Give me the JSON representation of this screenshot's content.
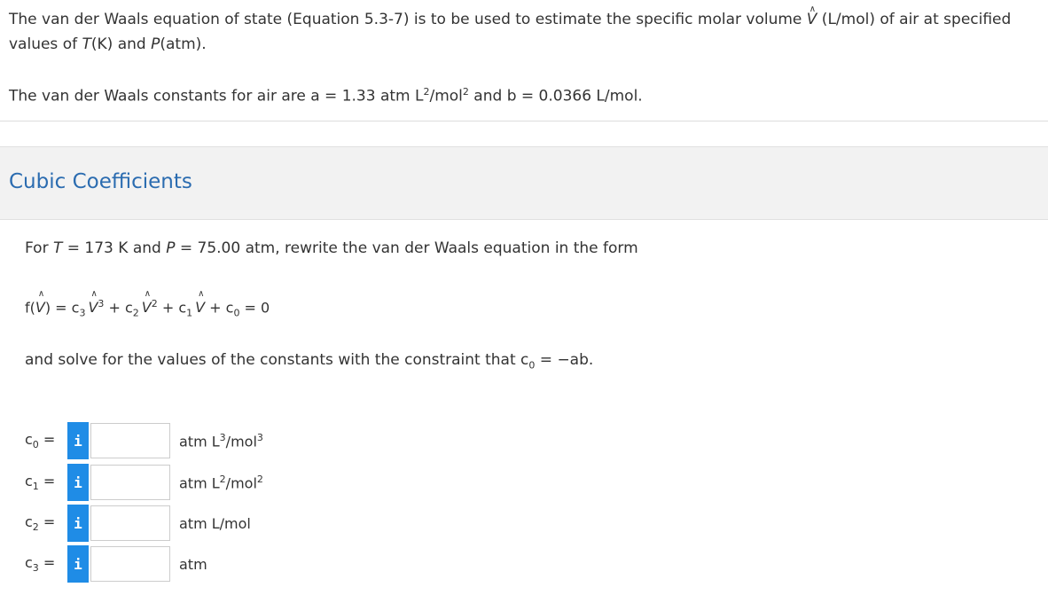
{
  "intro": {
    "line1_a": "The van der Waals equation of state (Equation 5.3-7) is to be used to estimate the specific molar volume ",
    "line1_var": "V",
    "line1_b": " (L/mol) of air at specified values of ",
    "T": "T",
    "line1_c": "(K) and ",
    "P": "P",
    "line1_d": "(atm).",
    "line2_a": "The van der Waals constants for air are a = 1.33 atm L",
    "line2_sup1": "2",
    "line2_b": "/mol",
    "line2_sup2": "2",
    "line2_c": " and b = 0.0366 L/mol."
  },
  "section": {
    "title": "Cubic Coefficients"
  },
  "question": {
    "line_a": "For ",
    "T": "T",
    "line_b": " = 173 K and ",
    "P": "P",
    "line_c": " = 75.00 atm, rewrite the van der Waals equation in the form",
    "eq": {
      "f": "f(",
      "V": "V",
      "close_eq": ") = c",
      "s3": "3",
      "p3": "3",
      "plus_c2": " + c",
      "s2": "2",
      "p2": "2",
      "plus_c1": " + c",
      "s1": "1",
      "plus_c0": " + c",
      "s0": "0",
      "eq0": " = 0"
    },
    "constraint_a": "and solve for the values of the constants with the constraint that c",
    "constraint_sub": "0",
    "constraint_b": " = −ab."
  },
  "answers": [
    {
      "label_c": "c",
      "label_sub": "0",
      "label_eq": " =",
      "info": "i",
      "value": "",
      "unit_a": "atm L",
      "unit_sup1": "3",
      "unit_b": "/mol",
      "unit_sup2": "3"
    },
    {
      "label_c": "c",
      "label_sub": "1",
      "label_eq": " =",
      "info": "i",
      "value": "",
      "unit_a": "atm L",
      "unit_sup1": "2",
      "unit_b": "/mol",
      "unit_sup2": "2"
    },
    {
      "label_c": "c",
      "label_sub": "2",
      "label_eq": " =",
      "info": "i",
      "value": "",
      "unit_a": "atm L/mol",
      "unit_sup1": "",
      "unit_b": "",
      "unit_sup2": ""
    },
    {
      "label_c": "c",
      "label_sub": "3",
      "label_eq": " =",
      "info": "i",
      "value": "",
      "unit_a": "atm",
      "unit_sup1": "",
      "unit_b": "",
      "unit_sup2": ""
    }
  ],
  "colors": {
    "accent": "#1f8ce6",
    "title": "#2b6cb0",
    "band": "#f2f2f2"
  }
}
